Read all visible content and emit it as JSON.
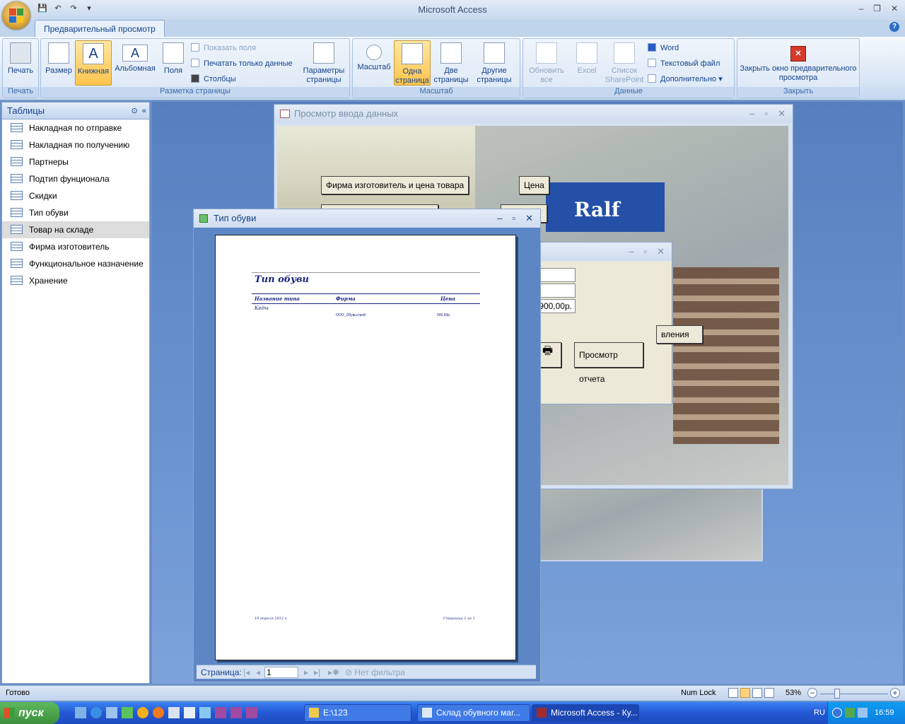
{
  "app": {
    "title": "Microsoft Access",
    "tab": "Предварительный просмотр"
  },
  "ribbon": {
    "print": {
      "label": "Печать",
      "group": "Печать"
    },
    "layout": {
      "group": "Разметка страницы",
      "size": "Размер",
      "portrait": "Книжная",
      "landscape": "Альбомная",
      "margins": "Поля",
      "show_fields": "Показать поля",
      "print_data_only": "Печатать только данные",
      "columns": "Столбцы",
      "page_setup": "Параметры страницы"
    },
    "zoom": {
      "group": "Масштаб",
      "zoom": "Масштаб",
      "one_page": "Одна страница",
      "two_pages": "Две страницы",
      "more_pages": "Другие страницы"
    },
    "data": {
      "group": "Данные",
      "refresh": "Обновить все",
      "excel": "Excel",
      "sharepoint": "Список SharePoint",
      "word": "Word",
      "text_file": "Текстовый файл",
      "more": "Дополнительно"
    },
    "close": {
      "group": "Закрыть",
      "label": "Закрыть окно предварительного просмотра"
    }
  },
  "nav": {
    "header": "Таблицы",
    "items": [
      "Накладная по отправке",
      "Накладная по получению",
      "Партнеры",
      "Подтип фунционала",
      "Скидки",
      "Тип обуви",
      "Товар на складе",
      "Фирма изготовитель",
      "Функциональное назначение",
      "Хранение"
    ],
    "selected": 6
  },
  "form_window": {
    "title": "Просмотр ввода данных",
    "btn_firm_price": "Фирма изготовитель и цена товара",
    "btn_price": "Цена"
  },
  "sub_window": {
    "value_price": "900,00р.",
    "btn_partial": "вления",
    "btn_report": "Просмотр отчета"
  },
  "report_window": {
    "title": "Тип обуви",
    "report_title": "Тип обуви",
    "headers": [
      "Название типа",
      "Фирма",
      "Цена"
    ],
    "rows": [
      {
        "type": "Кеды",
        "firm": "ООО_Обувьстрой",
        "price": "900,00р."
      }
    ],
    "footer_date": "19 апреля 2012 г.",
    "footer_page": "Страница 1 из 1",
    "page_label": "Страница:",
    "page_value": "1",
    "filter": "Нет фильтра"
  },
  "statusbar": {
    "status": "Готово",
    "numlock": "Num Lock",
    "zoom": "53%"
  },
  "taskbar": {
    "start": "пуск",
    "items": [
      "E:\\123",
      "Склад обувного маг...",
      "Microsoft Access - Ку..."
    ],
    "active": 2,
    "lang": "RU",
    "time": "16:59"
  }
}
